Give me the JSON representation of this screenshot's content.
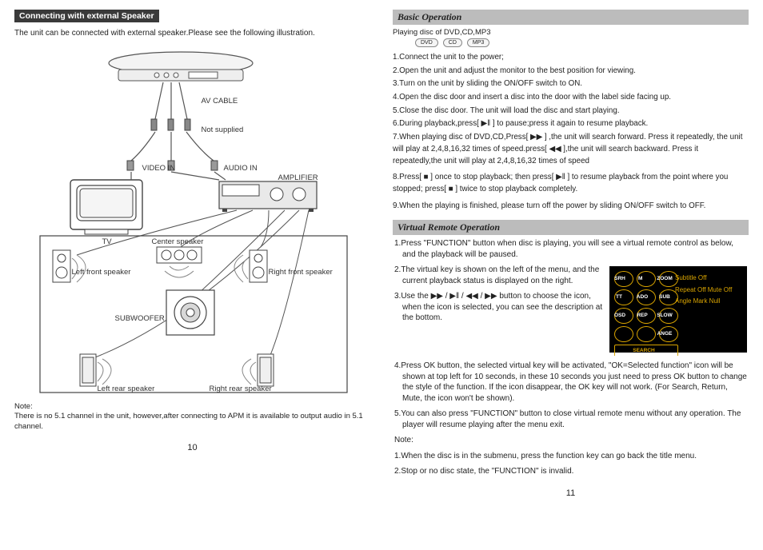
{
  "left": {
    "section_title": "Connecting with external Speaker",
    "intro": "The unit can be connected with external speaker.Please see the following illustration.",
    "labels": {
      "av_cable": "AV CABLE",
      "not_supplied": "Not supplied",
      "video_in": "VIDEO IN",
      "audio_in": "AUDIO IN",
      "amplifier": "AMPLIFIER",
      "tv": "TV",
      "center_speaker": "Center speaker",
      "left_front": "Left front speaker",
      "right_front": "Right front speaker",
      "subwoofer": "SUBWOOFER",
      "left_rear": "Left rear speaker",
      "right_rear": "Right rear speaker"
    },
    "note_label": "Note:",
    "note": "There is no 5.1 channel in the unit, however,after connecting to APM it is available to output audio in 5.1 channel.",
    "page": "10"
  },
  "right": {
    "basic_title": "Basic Operation",
    "subhead": "Playing disc of DVD,CD,MP3",
    "badges": [
      "DVD",
      "CD",
      "MP3"
    ],
    "steps": [
      "1.Connect the unit to the power;",
      "2.Open the unit and adjust the monitor to the best position for viewing.",
      "3.Turn on the unit by sliding the ON/OFF switch to ON.",
      "4.Open the disc door and insert a disc into the door with the label side facing up.",
      "5.Close the disc door. The unit will load the disc and start playing.",
      "6.During playback,press[ ▶‖ ] to pause;press it again to resume playback.",
      "7.When playing disc of DVD,CD,Press[ ▶▶ ] ,the unit will search forward. Press it repeatedly, the unit will play at 2,4,8,16,32 times of speed.press[ ◀◀ ],the unit will search backward. Press it repeatedly,the unit will play at 2,4,8,16,32 times of speed",
      "8.Press[ ■ ] once to stop playback; then press[ ▶‖ ] to resume playback from the point where you stopped; press[ ■ ] twice to stop playback completely.",
      "9.When the playing is finished, please turn off the power by sliding ON/OFF switch to OFF."
    ],
    "vro_title": "Virtual Remote Operation",
    "vro": [
      "1.Press \"FUNCTION\" button when disc is playing, you will see a virtual remote control as below, and the playback will be paused.",
      "2.The virtual key is shown on the left of the menu, and the current playback status is displayed on the right.",
      "3.Use the ▶▶ / ▶‖ / ◀◀ / ▶▶ button to choose the icon, when the icon is selected, you can see the description at the bottom.",
      "4.Press OK button, the selected virtual key will be activated, \"OK=Selected function\" icon will be shown at top left for 10 seconds, in these 10 seconds you just need to press OK button to change the style of the function. If the icon disappear, the OK key will not work. (For Search, Return, Mute, the icon won't be shown).",
      "5.You can also press \"FUNCTION\" button to close virtual remote menu without any operation. The player will resume playing after the menu exit."
    ],
    "vro_note_label": "Note:",
    "vro_notes": [
      "1.When the disc is in the submenu, press the function  key  can go back the title menu.",
      "2.Stop or no disc state, the \"FUNCTION\" is invalid."
    ],
    "remote": {
      "buttons": [
        "SRH",
        "M",
        "ZOOM",
        "TT",
        "ADO",
        "SUB",
        "OSD",
        "REP",
        "SLOW",
        "",
        "",
        "ANGE"
      ],
      "search": "SEARCH",
      "status": [
        "Subtitle Off",
        "Repeat Off    Mute Off",
        "Angle Mark Null"
      ]
    },
    "page": "11"
  }
}
